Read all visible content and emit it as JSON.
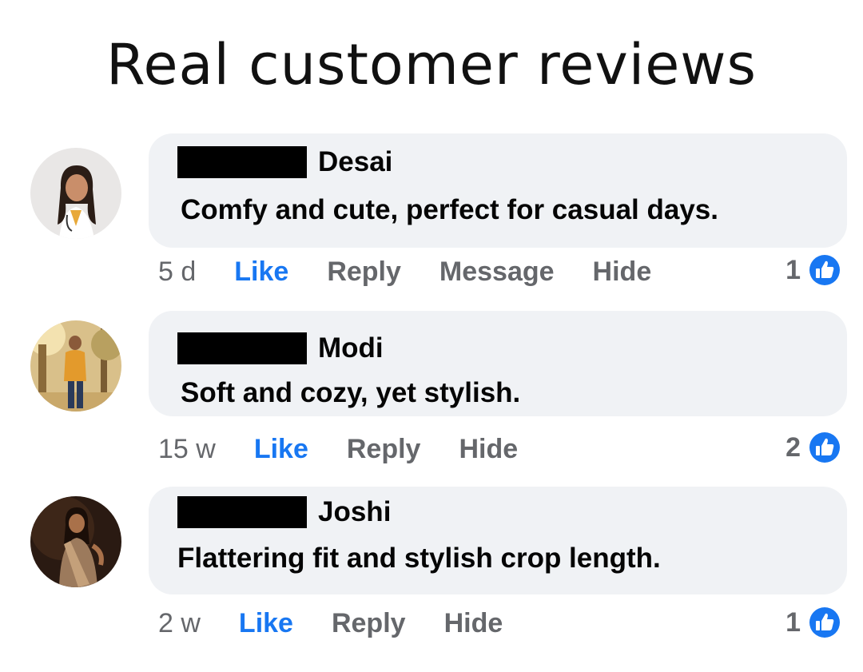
{
  "title": "Real customer reviews",
  "colors": {
    "bubble": "#f0f2f5",
    "like_blue": "#1877f2",
    "action_gray": "#65676b",
    "redaction": "#000000"
  },
  "comments": [
    {
      "name": "Desai",
      "text": "Comfy and cute, perfect for casual days.",
      "time": "5 d",
      "actions": [
        "Like",
        "Reply",
        "Message",
        "Hide"
      ],
      "reaction_count": "1",
      "reaction_icon": "like-thumb-icon"
    },
    {
      "name": "Modi",
      "text": "Soft and cozy, yet stylish.",
      "time": "15 w",
      "actions": [
        "Like",
        "Reply",
        "Hide"
      ],
      "reaction_count": "2",
      "reaction_icon": "like-thumb-icon"
    },
    {
      "name": "Joshi",
      "text": "Flattering fit and stylish crop length.",
      "time": "2 w",
      "actions": [
        "Like",
        "Reply",
        "Hide"
      ],
      "reaction_count": "1",
      "reaction_icon": "like-thumb-icon"
    }
  ]
}
